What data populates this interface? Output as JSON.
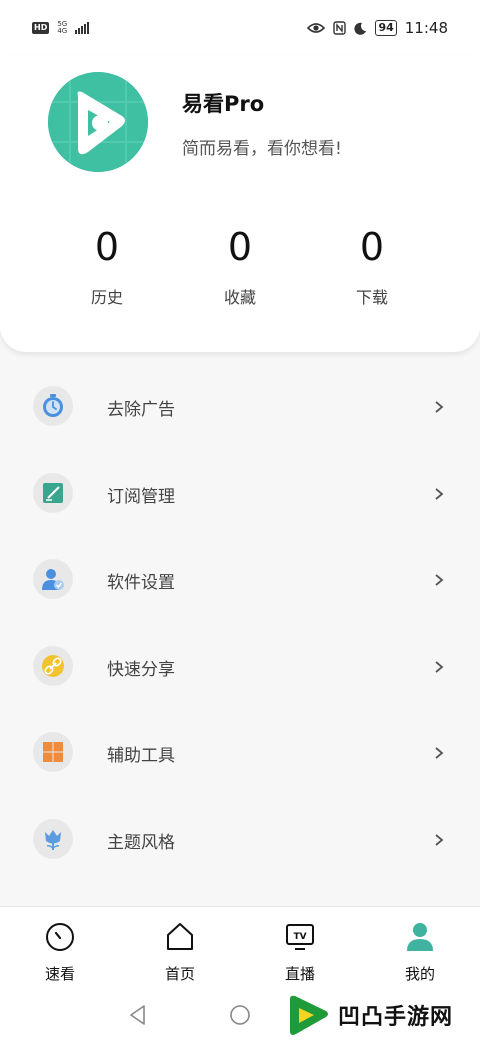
{
  "status_bar": {
    "hd": "HD",
    "network_top": "5G",
    "network_bottom": "4G",
    "battery": "94",
    "time": "11:48"
  },
  "profile": {
    "app_name": "易看Pro",
    "slogan": "简而易看，看你想看!",
    "avatar_icon": "play-logo-icon",
    "stats": [
      {
        "value": "0",
        "label": "历史"
      },
      {
        "value": "0",
        "label": "收藏"
      },
      {
        "value": "0",
        "label": "下载"
      }
    ]
  },
  "menu": {
    "items": [
      {
        "label": "去除广告",
        "icon": "timer-icon",
        "color": "#4a8fe0"
      },
      {
        "label": "订阅管理",
        "icon": "note-pen-icon",
        "color": "#3aa58e"
      },
      {
        "label": "软件设置",
        "icon": "user-settings-icon",
        "color": "#4a8fe0"
      },
      {
        "label": "快速分享",
        "icon": "link-icon",
        "color": "#f2c230"
      },
      {
        "label": "辅助工具",
        "icon": "grid-tools-icon",
        "color": "#f08a3c"
      },
      {
        "label": "主题风格",
        "icon": "tulip-icon",
        "color": "#5b9be0"
      }
    ]
  },
  "bottom_nav": {
    "items": [
      {
        "label": "速看",
        "icon": "clock-icon"
      },
      {
        "label": "首页",
        "icon": "home-icon"
      },
      {
        "label": "直播",
        "icon": "tv-icon"
      },
      {
        "label": "我的",
        "icon": "person-icon",
        "active": true
      }
    ],
    "active_color": "#3fb3a0"
  },
  "watermark": {
    "text": "凹凸手游网"
  }
}
